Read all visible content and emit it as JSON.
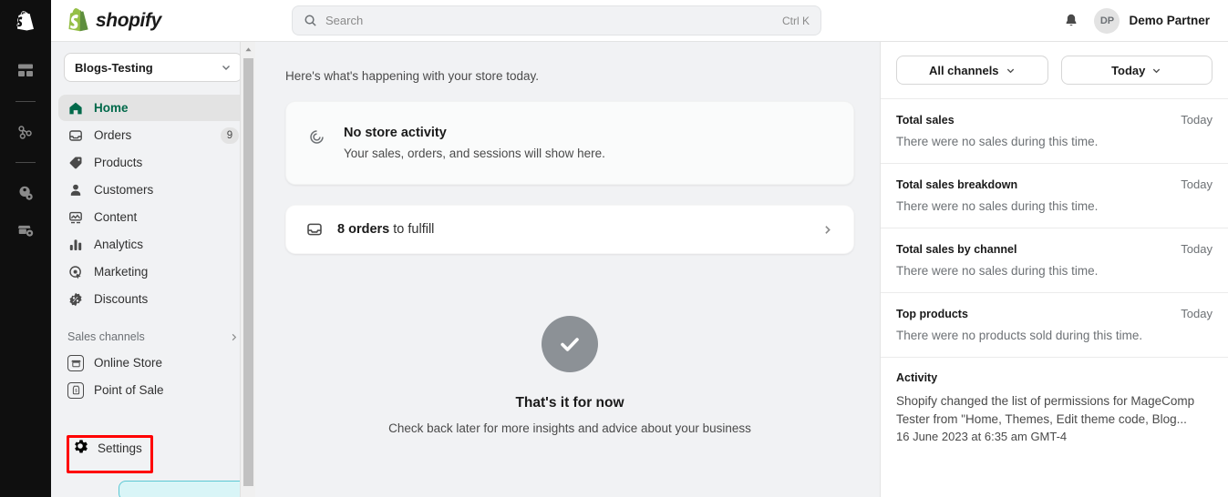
{
  "rail": {
    "icons": [
      {
        "name": "shopify-bag-icon"
      },
      {
        "name": "dashboard-grid-icon"
      },
      {
        "name": "network-share-icon"
      },
      {
        "name": "customer-settings-icon"
      },
      {
        "name": "store-settings-icon"
      }
    ]
  },
  "header": {
    "brand": "shopify",
    "search": {
      "placeholder": "Search",
      "shortcut": "Ctrl K",
      "icon": "search-icon"
    },
    "notifications_icon": "bell-icon",
    "user": {
      "initials": "DP",
      "name": "Demo Partner"
    }
  },
  "sidebar": {
    "store": {
      "name": "Blogs-Testing"
    },
    "items": [
      {
        "label": "Home",
        "icon": "home-icon",
        "active": true,
        "badge": ""
      },
      {
        "label": "Orders",
        "icon": "orders-inbox-icon",
        "active": false,
        "badge": "9"
      },
      {
        "label": "Products",
        "icon": "products-tag-icon",
        "active": false,
        "badge": ""
      },
      {
        "label": "Customers",
        "icon": "customers-person-icon",
        "active": false,
        "badge": ""
      },
      {
        "label": "Content",
        "icon": "content-media-icon",
        "active": false,
        "badge": ""
      },
      {
        "label": "Analytics",
        "icon": "analytics-bars-icon",
        "active": false,
        "badge": ""
      },
      {
        "label": "Marketing",
        "icon": "marketing-target-icon",
        "active": false,
        "badge": ""
      },
      {
        "label": "Discounts",
        "icon": "discounts-badge-icon",
        "active": false,
        "badge": ""
      }
    ],
    "sales_channels": {
      "label": "Sales channels",
      "items": [
        {
          "label": "Online Store",
          "icon": "online-store-icon"
        },
        {
          "label": "Point of Sale",
          "icon": "point-of-sale-icon"
        }
      ]
    },
    "settings": {
      "label": "Settings",
      "icon": "gear-icon",
      "highlight_color": "#ff0000"
    }
  },
  "main": {
    "greeting": "Here's what's happening with your store today.",
    "activity_card": {
      "icon": "store-activity-icon",
      "title": "No store activity",
      "subtitle": "Your sales, orders, and sessions will show here."
    },
    "orders_card": {
      "icon": "orders-inbox-icon",
      "count_text": "8 orders",
      "rest_text": " to fulfill",
      "chevron": "chevron-right-icon"
    },
    "empty_state": {
      "icon": "check-circle-icon",
      "title": "That's it for now",
      "subtitle": "Check back later for more insights and advice about your business"
    }
  },
  "right_panel": {
    "filters": [
      {
        "label": "All channels",
        "icon": "chevron-down-icon"
      },
      {
        "label": "Today",
        "icon": "chevron-down-icon"
      }
    ],
    "stats": [
      {
        "title": "Total sales",
        "period": "Today",
        "body": "There were no sales during this time."
      },
      {
        "title": "Total sales breakdown",
        "period": "Today",
        "body": "There were no sales during this time."
      },
      {
        "title": "Total sales by channel",
        "period": "Today",
        "body": "There were no sales during this time."
      },
      {
        "title": "Top products",
        "period": "Today",
        "body": "There were no products sold during this time."
      }
    ],
    "activity": {
      "title": "Activity",
      "body": "Shopify changed the list of permissions for MageComp Tester from \"Home, Themes, Edit theme code, Blog...",
      "timestamp": "16 June 2023 at 6:35 am GMT-4"
    }
  },
  "colors": {
    "brand_green": "#95BF47",
    "active_green": "#00694a",
    "annotation_red": "#ff0000",
    "panel_bg": "#f1f2f4"
  }
}
